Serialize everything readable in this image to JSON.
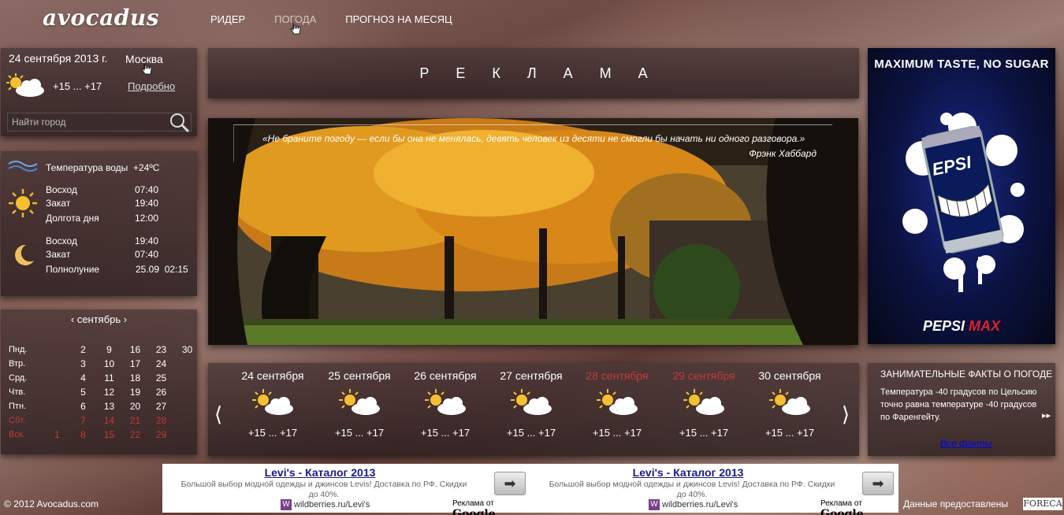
{
  "header": {
    "logo": "avocadus",
    "nav": [
      {
        "label": "РИДЕР"
      },
      {
        "label": "ПОГОДА"
      },
      {
        "label": "ПРОГНОЗ НА МЕСЯЦ"
      }
    ]
  },
  "city_panel": {
    "date": "24 сентября 2013 г.",
    "city": "Москва",
    "temp": "+15 ... +17",
    "details_link": "Подробно",
    "search_placeholder": "Найти город"
  },
  "astro": {
    "water_label": "Температура воды",
    "water_value": "+24ºC",
    "sun": [
      {
        "label": "Восход",
        "value": "07:40"
      },
      {
        "label": "Закат",
        "value": "19:40"
      },
      {
        "label": "Долгота дня",
        "value": "12:00"
      }
    ],
    "moon": [
      {
        "label": "Восход",
        "value": "19:40"
      },
      {
        "label": "Закат",
        "value": "07:40"
      },
      {
        "label": "Полнолуние",
        "value": "25.09  02:15"
      }
    ]
  },
  "calendar": {
    "month": "сентябрь",
    "prev": "‹",
    "next": "›",
    "rows": [
      {
        "day": "Пнд.",
        "dates": [
          "",
          "2",
          "9",
          "16",
          "23",
          "30"
        ],
        "weekend": false
      },
      {
        "day": "Втр.",
        "dates": [
          "",
          "3",
          "10",
          "17",
          "24",
          ""
        ],
        "weekend": false
      },
      {
        "day": "Срд.",
        "dates": [
          "",
          "4",
          "11",
          "18",
          "25",
          ""
        ],
        "weekend": false
      },
      {
        "day": "Чтв.",
        "dates": [
          "",
          "5",
          "12",
          "19",
          "26",
          ""
        ],
        "weekend": false
      },
      {
        "day": "Птн.",
        "dates": [
          "",
          "6",
          "13",
          "20",
          "27",
          ""
        ],
        "weekend": false
      },
      {
        "day": "Сбт.",
        "dates": [
          "",
          "7",
          "14",
          "21",
          "28",
          ""
        ],
        "weekend": true
      },
      {
        "day": "Вск.",
        "dates": [
          "1",
          "8",
          "15",
          "22",
          "29",
          ""
        ],
        "weekend": true
      }
    ]
  },
  "ad_banner": {
    "text": "РЕКЛАМА"
  },
  "quote": {
    "text": "«Не браните погоду — если бы она не менялась, девять человек из десяти не смогли бы начать ни одного разговора.»",
    "author": "Фрэнк Хаббард"
  },
  "forecast": {
    "prev": "⟨",
    "next": "⟩",
    "days": [
      {
        "date": "24 сентября",
        "temp": "+15 ... +17",
        "weekend": false
      },
      {
        "date": "25 сентября",
        "temp": "+15 ... +17",
        "weekend": false
      },
      {
        "date": "26 сентября",
        "temp": "+15 ... +17",
        "weekend": false
      },
      {
        "date": "27 сентября",
        "temp": "+15 ... +17",
        "weekend": false
      },
      {
        "date": "28 сентября",
        "temp": "+15 ... +17",
        "weekend": true
      },
      {
        "date": "29 сентября",
        "temp": "+15 ... +17",
        "weekend": true
      },
      {
        "date": "30 сентября",
        "temp": "+15 ... +17",
        "weekend": false
      }
    ]
  },
  "pepsi_ad": {
    "slogan": "MAXIMUM TASTE, NO SUGAR",
    "logo_main": "PEPSI",
    "logo_accent": "MAX"
  },
  "facts": {
    "title": "Занимательные факты о погоде",
    "text": "Температура -40 градусов по Цельсию точно равна температуре -40 градусов по Фаренгейту.",
    "more": "▸▸",
    "link": "Все факты"
  },
  "google_ads": [
    {
      "title": "Levi's - Каталог 2013",
      "desc": "Большой выбор модной одежды и джинсов Levis! Доставка по РФ. Скидки до 40%.",
      "url": "wildberries.ru/Levi's",
      "by": "Реклама от",
      "brand": "Google",
      "logo_letter": "W"
    },
    {
      "title": "Levi's - Каталог 2013",
      "desc": "Большой выбор модной одежды и джинсов Levis! Доставка по РФ. Скидки до 40%.",
      "url": "wildberries.ru/Levi's",
      "by": "Реклама от",
      "brand": "Google",
      "logo_letter": "W"
    }
  ],
  "footer": {
    "copyright": "© 2012 Avocadus.com",
    "data_by": "Данные предоставлены",
    "provider": "FORECA"
  }
}
